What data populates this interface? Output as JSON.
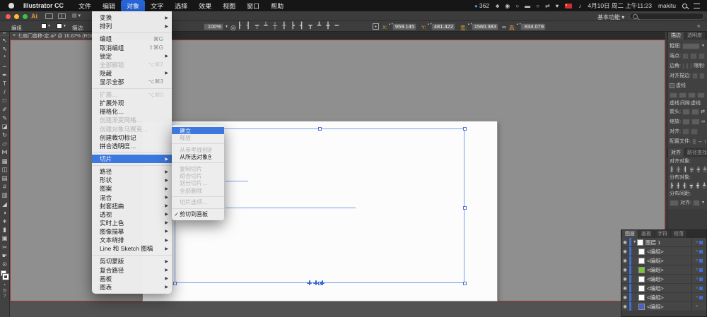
{
  "menubar": {
    "app_name": "Illustrator CC",
    "items": [
      {
        "label": "文件",
        "cls": ""
      },
      {
        "label": "编辑",
        "cls": ""
      },
      {
        "label": "对象",
        "cls": "active"
      },
      {
        "label": "文字",
        "cls": ""
      },
      {
        "label": "选择",
        "cls": ""
      },
      {
        "label": "效果",
        "cls": ""
      },
      {
        "label": "视图",
        "cls": ""
      },
      {
        "label": "窗口",
        "cls": ""
      },
      {
        "label": "帮助",
        "cls": ""
      }
    ],
    "badge_count": "362",
    "status_icons": [
      "♣",
      "◉",
      "○",
      "▬",
      "○",
      "⇄",
      "♥"
    ],
    "sound_icon": "♪",
    "date": "4月10日 周二 上午11:23",
    "user": "makitu"
  },
  "titlebar": {
    "logo": "Ai",
    "arrange_dd": "▤ ▾",
    "workspace": "基本功能 ▾"
  },
  "controlbar": {
    "group_label": "编组",
    "stroke_label": "描边:",
    "opacity": "100%",
    "icons": [
      "┠",
      "┨",
      "┯",
      "┷",
      "┼",
      "╂",
      "┣",
      "┫",
      "┳",
      "┻",
      "╋",
      "━"
    ],
    "x_label": "X:",
    "x": "959.145",
    "y_label": "Y:",
    "y": "481.422",
    "w_label": "宽:",
    "w": "1560.383",
    "link_icon": "∞",
    "h_label": "高:",
    "h": "834.079"
  },
  "doc_tab": {
    "close": "×",
    "title": "七扇门兽移-定.ai* @ 16.67% (RGB/GPU 预览)"
  },
  "object_menu": {
    "items": [
      {
        "label": "变换",
        "cls": "sub"
      },
      {
        "label": "排列",
        "cls": "sub"
      },
      {
        "cls": "sep"
      },
      {
        "label": "编组",
        "shortcut": "⌘G"
      },
      {
        "label": "取消编组",
        "shortcut": "⇧⌘G"
      },
      {
        "label": "锁定",
        "cls": "sub"
      },
      {
        "label": "全部解锁",
        "shortcut": "⌥⌘2",
        "cls": "disabled"
      },
      {
        "label": "隐藏",
        "cls": "sub"
      },
      {
        "label": "显示全部",
        "shortcut": "⌥⌘3"
      },
      {
        "cls": "sep"
      },
      {
        "label": "扩展…",
        "shortcut": "⌥⌘0",
        "cls": "disabled"
      },
      {
        "label": "扩展外观"
      },
      {
        "label": "栅格化…"
      },
      {
        "label": "创建渐变网格…",
        "cls": "disabled"
      },
      {
        "label": "创建对象马赛克…",
        "cls": "disabled"
      },
      {
        "label": "创建裁切标记"
      },
      {
        "label": "拼合透明度…"
      },
      {
        "cls": "sep"
      },
      {
        "label": "切片",
        "cls": "sub hl"
      },
      {
        "cls": "sep"
      },
      {
        "label": "路径",
        "cls": "sub"
      },
      {
        "label": "形状",
        "cls": "sub"
      },
      {
        "label": "图案",
        "cls": "sub"
      },
      {
        "label": "混合",
        "cls": "sub"
      },
      {
        "label": "封套扭曲",
        "cls": "sub"
      },
      {
        "label": "透视",
        "cls": "sub"
      },
      {
        "label": "实时上色",
        "cls": "sub"
      },
      {
        "label": "图像描摹",
        "cls": "sub"
      },
      {
        "label": "文本绕排",
        "cls": "sub"
      },
      {
        "label": "Line 和 Sketch 图稿",
        "cls": "sub"
      },
      {
        "cls": "sep"
      },
      {
        "label": "剪切蒙版",
        "cls": "sub"
      },
      {
        "label": "复合路径",
        "cls": "sub"
      },
      {
        "label": "画板",
        "cls": "sub"
      },
      {
        "label": "图表",
        "cls": "sub"
      }
    ]
  },
  "slice_submenu": {
    "items": [
      {
        "label": "建立",
        "cls": "hl"
      },
      {
        "label": "释放",
        "cls": "disabled"
      },
      {
        "cls": "sep"
      },
      {
        "label": "从参考线创建",
        "cls": "disabled"
      },
      {
        "label": "从所选对象创建"
      },
      {
        "cls": "sep"
      },
      {
        "label": "复制切片",
        "cls": "disabled"
      },
      {
        "label": "组合切片",
        "cls": "disabled"
      },
      {
        "label": "划分切片…",
        "cls": "disabled"
      },
      {
        "label": "全部删除",
        "cls": "disabled"
      },
      {
        "cls": "sep"
      },
      {
        "label": "切片选项…",
        "cls": "disabled"
      },
      {
        "cls": "sep"
      },
      {
        "label": "剪切到画板",
        "check": "✓"
      }
    ]
  },
  "toolbar": {
    "tools": [
      {
        "n": "selection-tool-icon",
        "g": "↖"
      },
      {
        "n": "direct-selection-tool-icon",
        "g": "⇖"
      },
      {
        "n": "magic-wand-tool-icon",
        "g": "*"
      },
      {
        "n": "lasso-tool-icon",
        "g": "∽"
      },
      {
        "n": "pen-tool-icon",
        "g": "✒"
      },
      {
        "n": "type-tool-icon",
        "g": "T"
      },
      {
        "n": "line-segment-tool-icon",
        "g": "/"
      },
      {
        "n": "rectangle-tool-icon",
        "g": "□"
      },
      {
        "n": "paintbrush-tool-icon",
        "g": "✐"
      },
      {
        "n": "pencil-tool-icon",
        "g": "✎"
      },
      {
        "n": "eraser-tool-icon",
        "g": "◪"
      },
      {
        "n": "rotate-tool-icon",
        "g": "↻"
      },
      {
        "n": "scale-tool-icon",
        "g": "▱"
      },
      {
        "n": "width-tool-icon",
        "g": "⋈"
      },
      {
        "n": "free-transform-tool-icon",
        "g": "▦"
      },
      {
        "n": "shape-builder-tool-icon",
        "g": "◫"
      },
      {
        "n": "perspective-grid-tool-icon",
        "g": "▤"
      },
      {
        "n": "mesh-tool-icon",
        "g": "#"
      },
      {
        "n": "gradient-tool-icon",
        "g": "▥"
      },
      {
        "n": "eyedropper-tool-icon",
        "g": "◢"
      },
      {
        "n": "blend-tool-icon",
        "g": "◑"
      },
      {
        "n": "symbol-sprayer-tool-icon",
        "g": "∗"
      },
      {
        "n": "column-graph-tool-icon",
        "g": "▮"
      },
      {
        "n": "artboard-tool-icon",
        "g": "▣"
      },
      {
        "n": "slice-tool-icon",
        "g": "✂"
      },
      {
        "n": "hand-tool-icon",
        "g": "☛"
      },
      {
        "n": "zoom-tool-icon",
        "g": "⊙"
      }
    ]
  },
  "panels": {
    "stroke": {
      "tabs": [
        {
          "label": "描边",
          "cls": "active"
        },
        {
          "label": "透明度",
          "cls": ""
        }
      ],
      "weight_label": "粗细:",
      "cap_label": "端点:",
      "corner_label": "边角:",
      "limit_label": "限制:",
      "align_stroke_label": "对齐描边:",
      "dashed_label": "虚线",
      "dash_labels": [
        "虚线",
        "间隙",
        "虚线"
      ],
      "arrow_label": "箭头:",
      "swap_icon": "⇄",
      "scale_label": "缩放:",
      "link_icon": "∞",
      "align_label": "对齐:",
      "profile_label": "配置文件:",
      "flip_icons": "↔ ↕"
    },
    "align": {
      "tabs": [
        {
          "label": "对齐",
          "cls": "active"
        },
        {
          "label": "路径查找器",
          "cls": ""
        }
      ],
      "align_objects_label": "对齐对象:",
      "align_icons": [
        "┠",
        "┼",
        "┨",
        "┯",
        "┿",
        "┷"
      ],
      "distribute_label": "分布对象:",
      "distribute_icons": [
        "┣",
        "╂",
        "┫",
        "┳",
        "╋",
        "┻"
      ],
      "spacing_label": "分布间距:",
      "align_to_label": "对齐:"
    },
    "layers": {
      "tabs": [
        {
          "label": "图层",
          "cls": "active"
        },
        {
          "label": "画板",
          "cls": ""
        },
        {
          "label": "字符",
          "cls": ""
        },
        {
          "label": "段落",
          "cls": ""
        }
      ],
      "rows": [
        {
          "name": "图层 1",
          "arrow": "▼",
          "pad": "2px",
          "swatch": "#ffffff",
          "selcls": "on"
        },
        {
          "name": "<编组>",
          "arrow": "▶",
          "pad": "10px",
          "swatch": "#ffffff",
          "selcls": "on"
        },
        {
          "name": "<编组>",
          "arrow": "▶",
          "pad": "10px",
          "swatch": "#ffffff",
          "selcls": "on"
        },
        {
          "name": "<编组>",
          "arrow": "▶",
          "pad": "10px",
          "swatch": "#77c832",
          "selcls": "on"
        },
        {
          "name": "<编组>",
          "arrow": "▶",
          "pad": "10px",
          "swatch": "#ffffff",
          "selcls": "on"
        },
        {
          "name": "<编组>",
          "arrow": "▶",
          "pad": "10px",
          "swatch": "#ffffff",
          "selcls": "on"
        },
        {
          "name": "<编组>",
          "arrow": "▶",
          "pad": "10px",
          "swatch": "#ffffff",
          "selcls": "on"
        },
        {
          "name": "<编组>",
          "arrow": "▶",
          "pad": "10px",
          "swatch": "#4a5fc8",
          "selcls": ""
        }
      ]
    }
  }
}
